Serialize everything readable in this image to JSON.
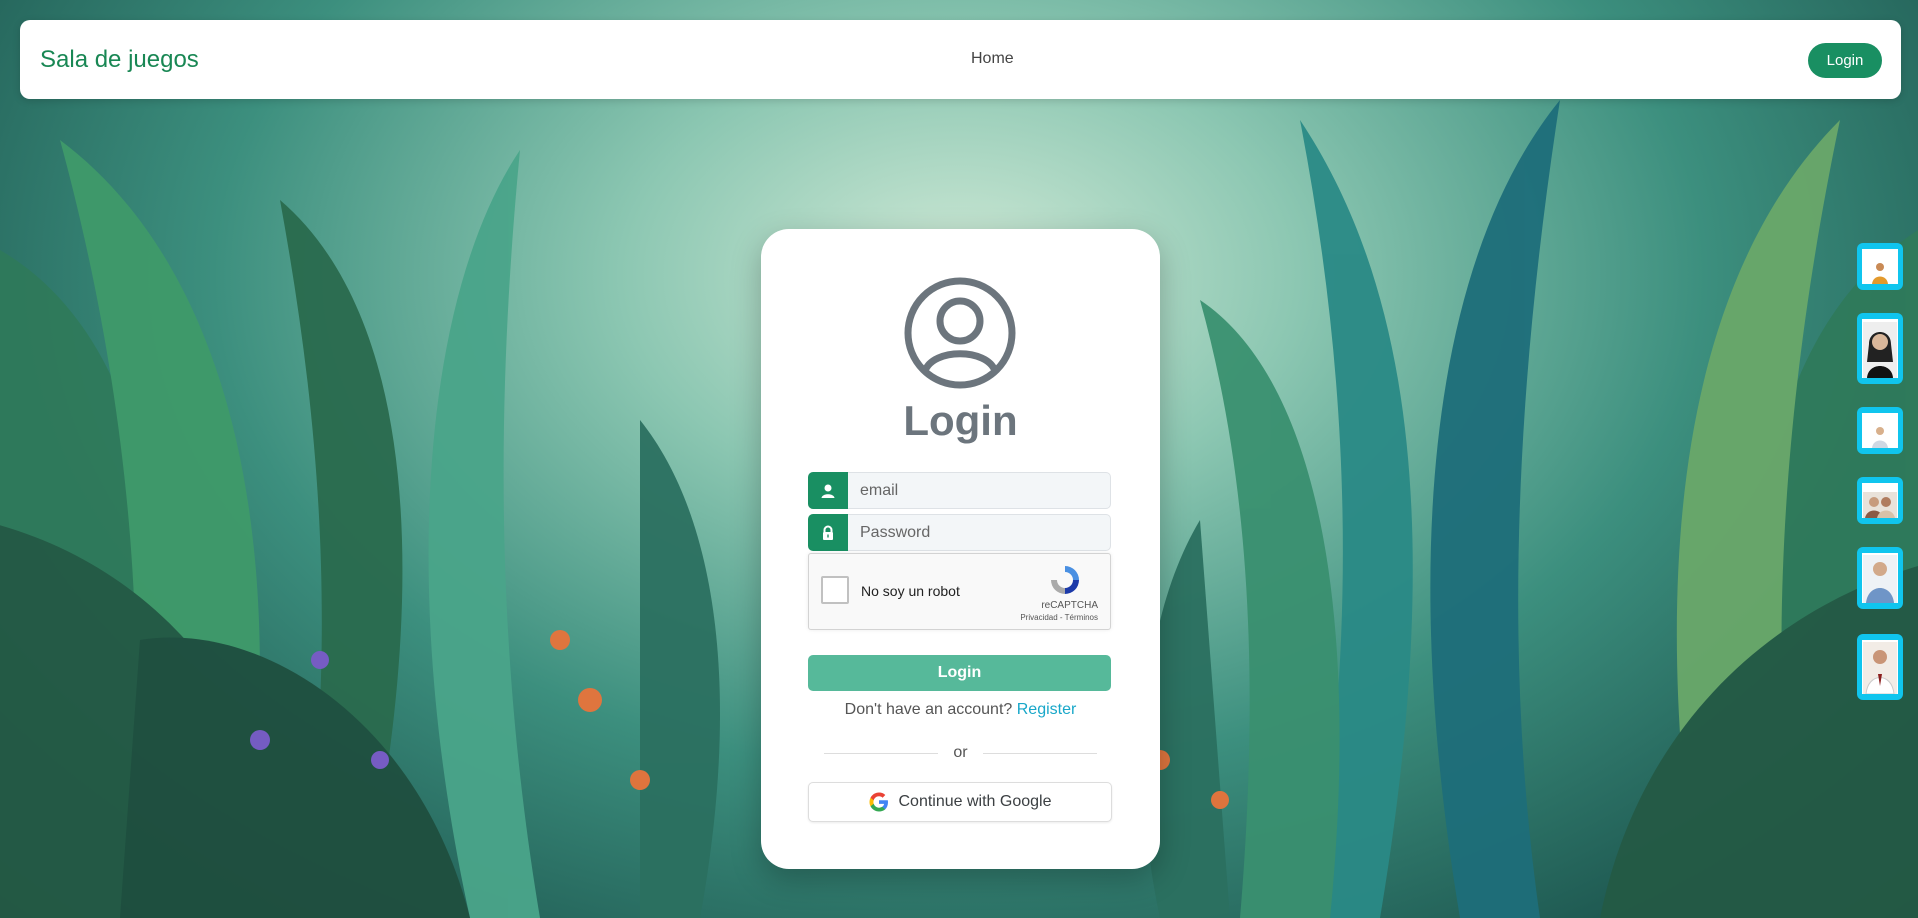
{
  "navbar": {
    "brand": "Sala de juegos",
    "home_label": "Home",
    "login_label": "Login"
  },
  "login_card": {
    "title": "Login",
    "email_placeholder": "email",
    "password_placeholder": "Password",
    "captcha": {
      "label": "No soy un robot",
      "brand": "reCAPTCHA",
      "links": "Privacidad - Términos"
    },
    "submit_label": "Login",
    "account_prompt": "Don't have an account?",
    "register_link": "Register",
    "divider_text": "or",
    "google_label": "Continue with Google"
  },
  "quick_access_users": [
    {
      "icon": "user-photo-1"
    },
    {
      "icon": "user-photo-2"
    },
    {
      "icon": "user-photo-3"
    },
    {
      "icon": "user-photo-4"
    },
    {
      "icon": "user-photo-5"
    },
    {
      "icon": "user-photo-6"
    }
  ],
  "colors": {
    "brand_green": "#198754",
    "button_green": "#198f62",
    "login_button": "#56b99a",
    "register_link": "#18a7c9",
    "thumb_border": "#10c5ee"
  }
}
